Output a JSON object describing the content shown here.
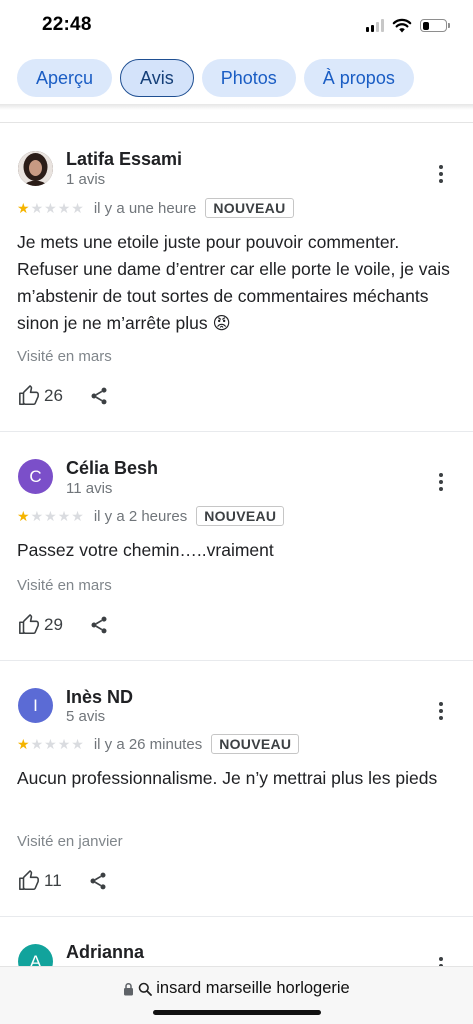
{
  "status_bar": {
    "time": "22:48",
    "battery_level": 0.3
  },
  "tabs": [
    {
      "label": "Aperçu",
      "active": false
    },
    {
      "label": "Avis",
      "active": true
    },
    {
      "label": "Photos",
      "active": false
    },
    {
      "label": "À propos",
      "active": false
    }
  ],
  "reviews": [
    {
      "name": "Latifa Essami",
      "review_count": "1 avis",
      "rating": 1,
      "time_ago": "il y a une heure",
      "badge": "NOUVEAU",
      "text": "Je mets une etoile juste pour pouvoir commenter. Refuser une dame d’entrer car elle porte le voile, je vais m’abstenir de tout sortes de commentaires méchants sinon je ne m’arrête plus 😡",
      "visited": "Visité en mars",
      "likes": "26",
      "avatar_initial": "",
      "avatar_color": "#3a2a24"
    },
    {
      "name": "Célia Besh",
      "review_count": "11 avis",
      "rating": 1,
      "time_ago": "il y a 2 heures",
      "badge": "NOUVEAU",
      "text": "Passez votre chemin…..vraiment",
      "visited": "Visité en mars",
      "likes": "29",
      "avatar_initial": "C",
      "avatar_color": "#7b4fc9"
    },
    {
      "name": "Inès ND",
      "review_count": "5 avis",
      "rating": 1,
      "time_ago": "il y a 26 minutes",
      "badge": "NOUVEAU",
      "text": "Aucun professionnalisme. Je n’y mettrai plus les pieds",
      "visited": "Visité en janvier",
      "likes": "11",
      "avatar_initial": "I",
      "avatar_color": "#5b6bd5"
    },
    {
      "name": "Adrianna",
      "avatar_initial": "A",
      "avatar_color": "#12a39c"
    }
  ],
  "address_bar": {
    "text": "insard marseille horlogerie"
  },
  "colors": {
    "accent": "#1a5dc4",
    "star": "#f5b400"
  }
}
